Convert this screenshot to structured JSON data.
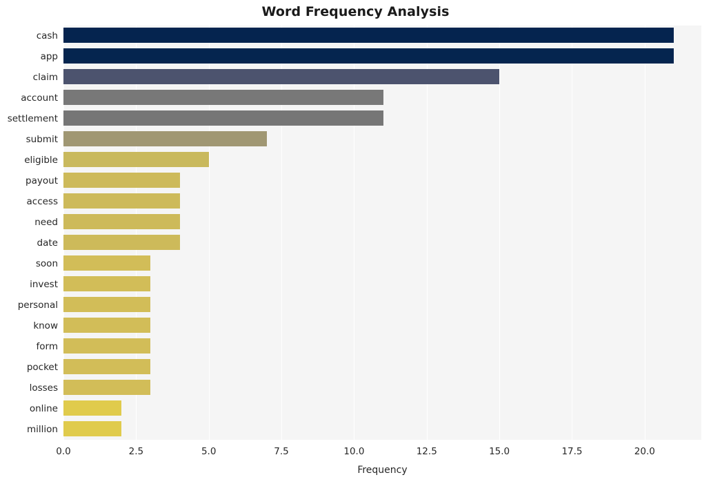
{
  "chart_data": {
    "type": "bar",
    "orientation": "horizontal",
    "title": "Word Frequency Analysis",
    "xlabel": "Frequency",
    "ylabel": "",
    "categories": [
      "cash",
      "app",
      "claim",
      "account",
      "settlement",
      "submit",
      "eligible",
      "payout",
      "access",
      "need",
      "date",
      "soon",
      "invest",
      "personal",
      "know",
      "form",
      "pocket",
      "losses",
      "online",
      "million"
    ],
    "values": [
      21,
      21,
      15,
      11,
      11,
      7,
      5,
      4,
      4,
      4,
      4,
      3,
      3,
      3,
      3,
      3,
      3,
      3,
      2,
      2
    ],
    "bar_colors": [
      "#05244f",
      "#05254f",
      "#4c536e",
      "#787878",
      "#767676",
      "#a09773",
      "#c9b95d",
      "#cdba5a",
      "#cdba5a",
      "#cdba5a",
      "#cdba5a",
      "#d2bd58",
      "#d2bd58",
      "#d2bd58",
      "#d2bd58",
      "#d2bd58",
      "#d2bd58",
      "#d2bd58",
      "#e0cb4c",
      "#e0cb4c"
    ],
    "xlim": [
      0,
      21.95
    ],
    "xticks": [
      0.0,
      2.5,
      5.0,
      7.5,
      10.0,
      12.5,
      15.0,
      17.5,
      20.0
    ],
    "xtick_labels": [
      "0.0",
      "2.5",
      "5.0",
      "7.5",
      "10.0",
      "12.5",
      "15.0",
      "17.5",
      "20.0"
    ],
    "grid": true,
    "grid_axis": "x",
    "legend": null,
    "plot_background": "#f5f5f5",
    "figure_background": "#ffffff"
  }
}
